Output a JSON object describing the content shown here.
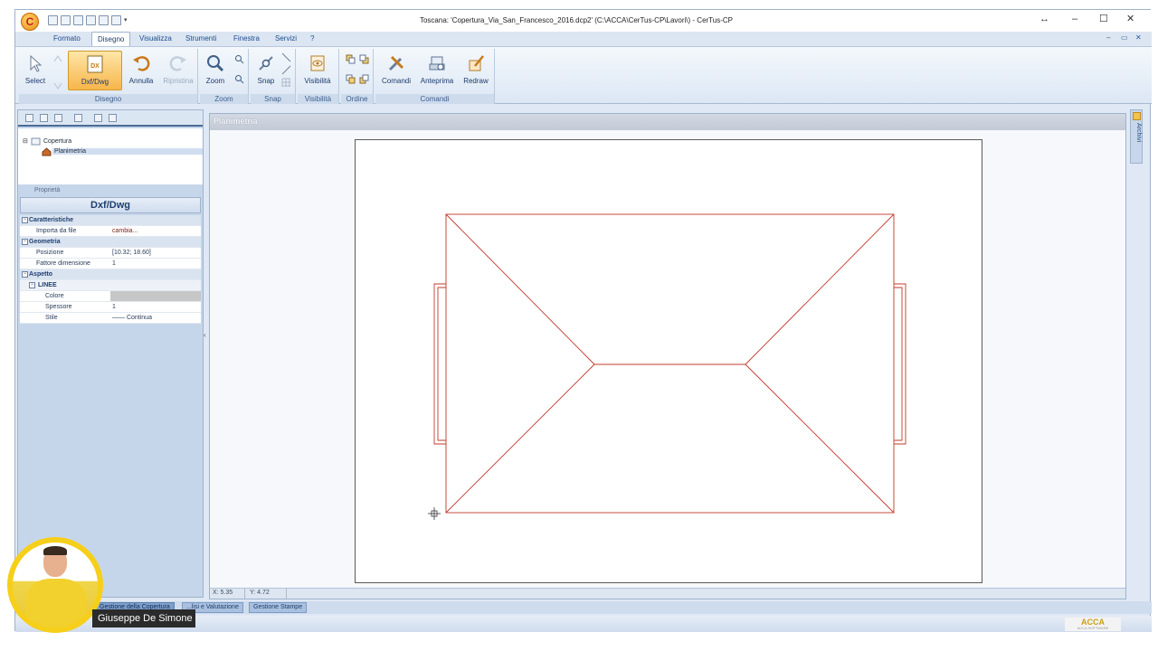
{
  "titlebar": {
    "title": "Toscana: 'Copertura_Via_San_Francesco_2016.dcp2'  (C:\\ACCA\\CerTus-CP\\Lavori\\) - CerTus-CP",
    "app_logo": "C",
    "resize_icon": "↔",
    "minimize": "–",
    "maximize": "☐",
    "close": "✕",
    "mdi_minimize": "–",
    "mdi_restore": "▭",
    "mdi_close": "✕"
  },
  "menu": {
    "tabs": [
      "Formato",
      "Disegno",
      "Visualizza",
      "Strumenti",
      "Finestra",
      "Servizi",
      "?"
    ],
    "active": "Disegno"
  },
  "ribbon": {
    "groups": [
      {
        "label": "Disegno",
        "buttons": [
          {
            "label": "Select",
            "icon": "cursor-icon"
          },
          {
            "label": "Dxf/Dwg",
            "icon": "dxf-icon",
            "pressed": true
          },
          {
            "label": "Annulla",
            "icon": "undo-icon"
          },
          {
            "label": "Ripristina",
            "icon": "redo-icon",
            "disabled": true
          }
        ]
      },
      {
        "label": "Zoom",
        "buttons": [
          {
            "label": "Zoom",
            "icon": "magnifier-icon"
          }
        ]
      },
      {
        "label": "Snap",
        "buttons": [
          {
            "label": "Snap",
            "icon": "snap-icon"
          }
        ]
      },
      {
        "label": "Visibilità",
        "buttons": [
          {
            "label": "Visibilità",
            "icon": "visibility-icon"
          }
        ]
      },
      {
        "label": "Ordine",
        "buttons": []
      },
      {
        "label": "Comandi",
        "buttons": [
          {
            "label": "Comandi",
            "icon": "tools-icon"
          },
          {
            "label": "Anteprima",
            "icon": "preview-icon"
          },
          {
            "label": "Redraw",
            "icon": "redraw-icon"
          }
        ]
      }
    ],
    "accent": "#f7b64a"
  },
  "tree": {
    "root": "Copertura",
    "child": "Planimetria"
  },
  "properties": {
    "header": "Proprietà",
    "title": "Dxf/Dwg",
    "sections": {
      "caratteristiche": "Caratteristiche",
      "geometria": "Geometria",
      "aspetto": "Aspetto",
      "linee": "LINEE"
    },
    "rows": {
      "importa_key": "Importa da file",
      "importa_val": "cambia...",
      "posizione_key": "Posizione",
      "posizione_val": "[10.32; 18.60]",
      "fattore_key": "Fattore dimensione",
      "fattore_val": "1",
      "colore_key": "Colore",
      "spessore_key": "Spessore",
      "spessore_val": "1",
      "stile_key": "Stile",
      "stile_val": "—— Continua"
    }
  },
  "document": {
    "title": "Planimetria",
    "line_color": "#c0392b"
  },
  "status": {
    "x": "X: 5.35",
    "y": "Y: 4.72"
  },
  "right_strip": {
    "label": "Archivi"
  },
  "bottom_tabs": [
    "Gestione della Copertura",
    "...lisi e Valutazione",
    "Gestione Stampe"
  ],
  "brand": {
    "logo": "ACCA",
    "sub": "ACCA SOFTWARE"
  },
  "presenter": {
    "name": "Giuseppe De Simone"
  }
}
